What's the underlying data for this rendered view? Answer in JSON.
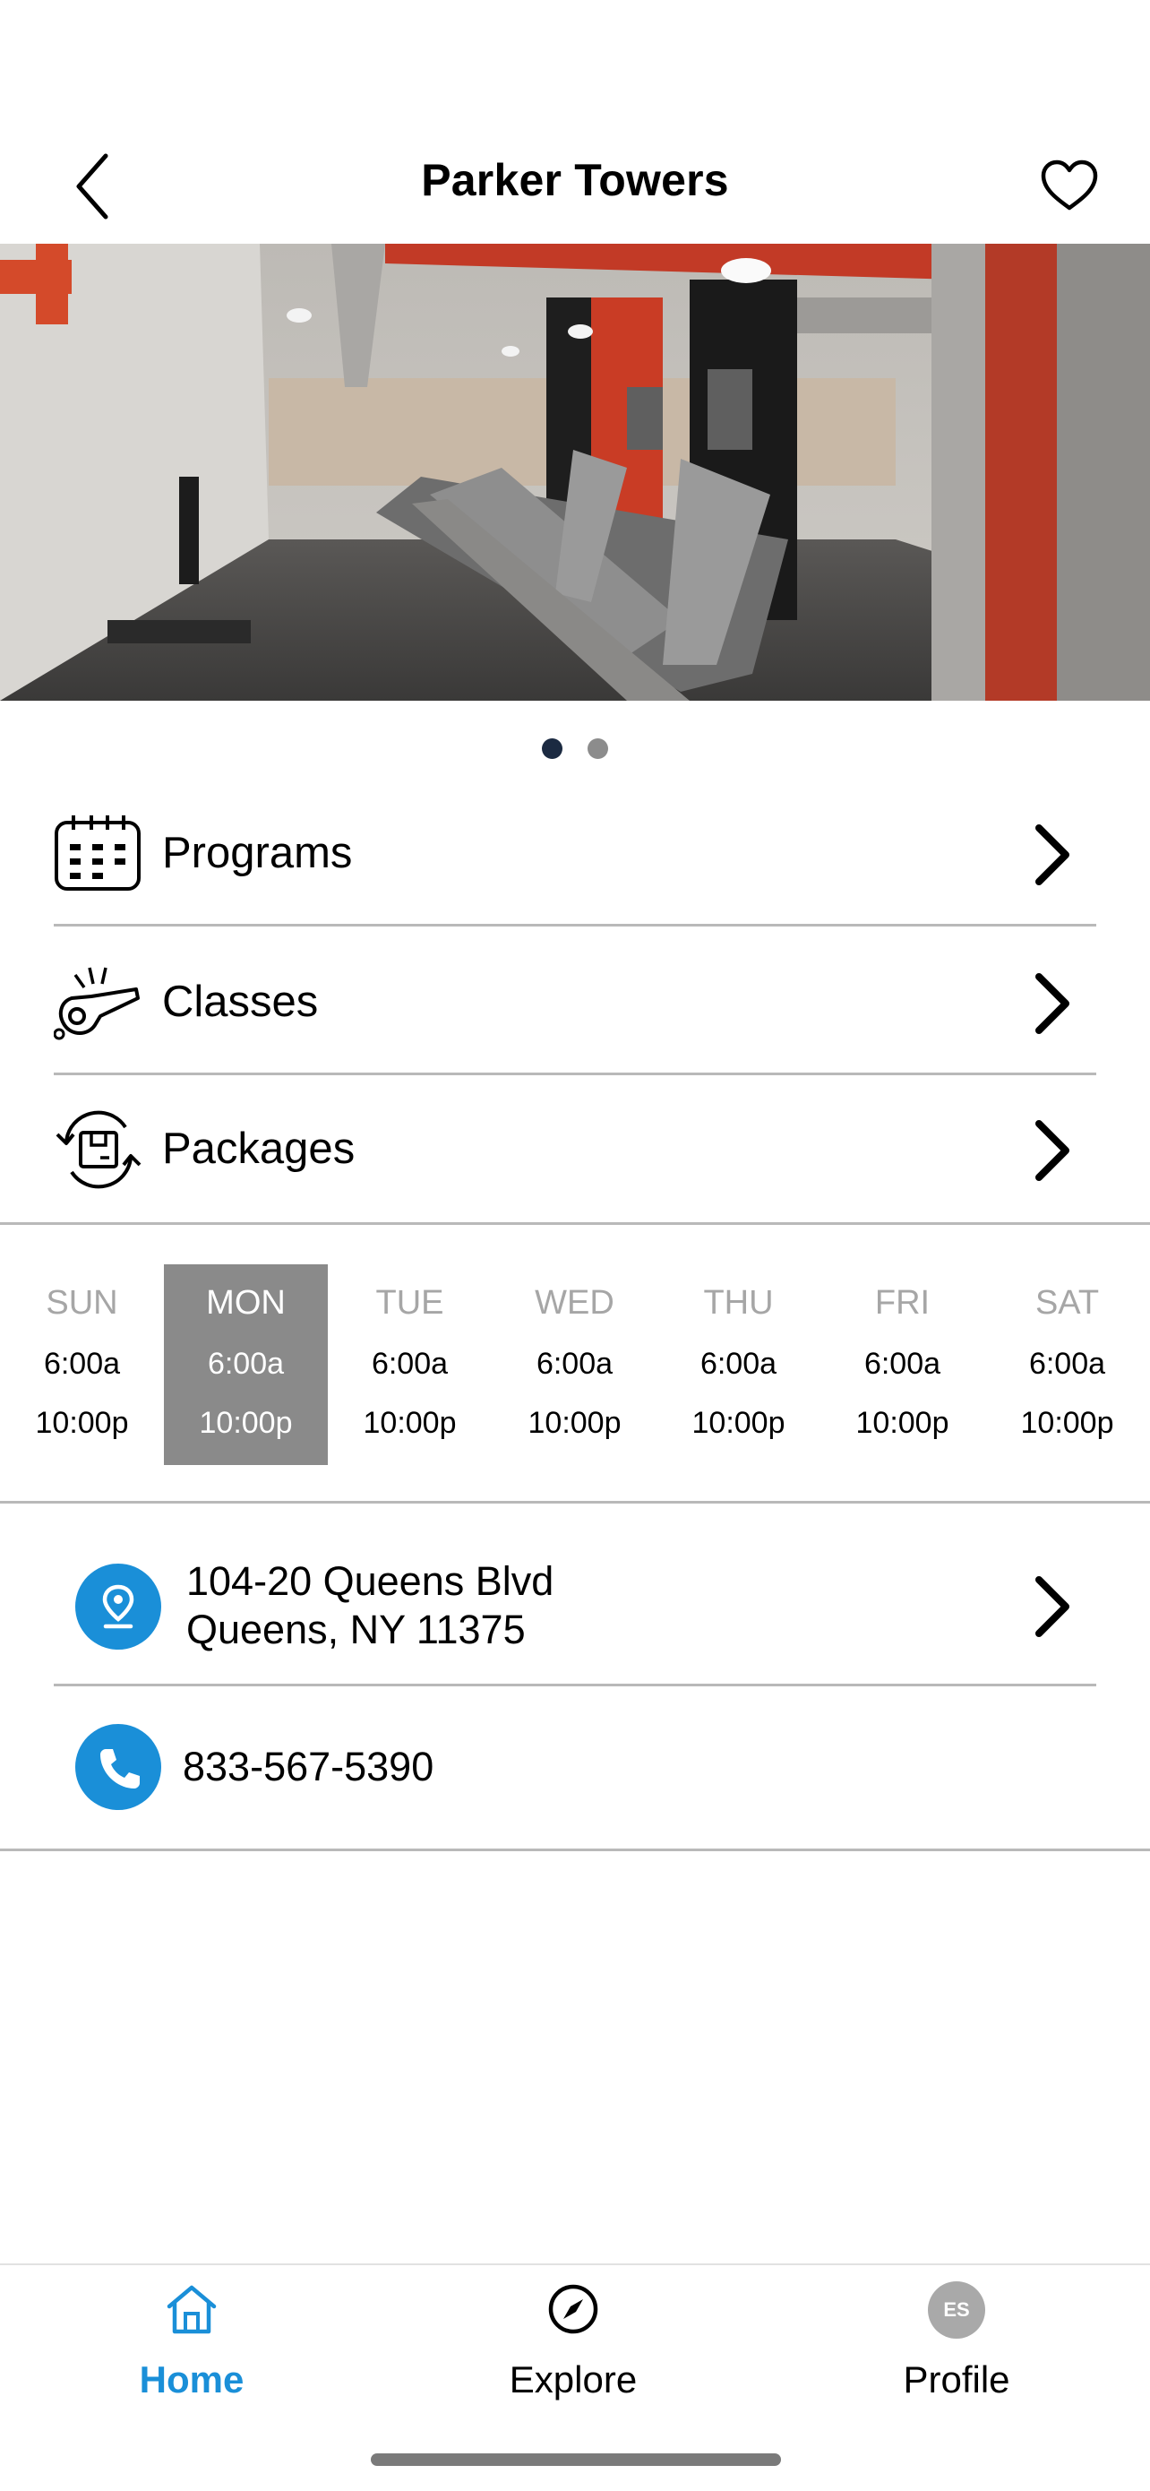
{
  "header": {
    "title": "Parker Towers",
    "back_icon": "chevron-left-icon",
    "favorite_icon": "heart-outline-icon"
  },
  "carousel": {
    "page_count": 2,
    "current_page": 1
  },
  "menu": [
    {
      "label": "Programs",
      "icon": "calendar-grid-icon"
    },
    {
      "label": "Classes",
      "icon": "whistle-icon"
    },
    {
      "label": "Packages",
      "icon": "package-cycle-icon"
    }
  ],
  "hours": [
    {
      "day": "SUN",
      "open": "6:00a",
      "close": "10:00p",
      "active": false
    },
    {
      "day": "MON",
      "open": "6:00a",
      "close": "10:00p",
      "active": true
    },
    {
      "day": "TUE",
      "open": "6:00a",
      "close": "10:00p",
      "active": false
    },
    {
      "day": "WED",
      "open": "6:00a",
      "close": "10:00p",
      "active": false
    },
    {
      "day": "THU",
      "open": "6:00a",
      "close": "10:00p",
      "active": false
    },
    {
      "day": "FRI",
      "open": "6:00a",
      "close": "10:00p",
      "active": false
    },
    {
      "day": "SAT",
      "open": "6:00a",
      "close": "10:00p",
      "active": false
    }
  ],
  "contact": {
    "address_line1": "104-20 Queens Blvd",
    "address_line2": "Queens, NY 11375",
    "phone": "833-567-5390"
  },
  "tabbar": {
    "home": "Home",
    "explore": "Explore",
    "profile": "Profile",
    "profile_initials": "ES"
  },
  "colors": {
    "accent": "#1a8fd8",
    "active_day_bg": "#8a8a8a",
    "dot_active": "#1b2a41",
    "dot_inactive": "#8c8c8c"
  }
}
